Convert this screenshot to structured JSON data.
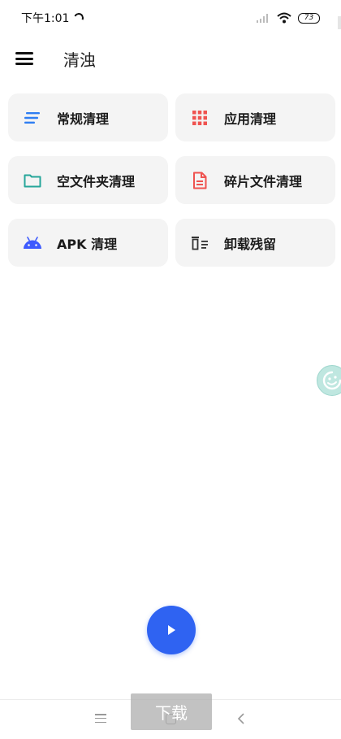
{
  "status_bar": {
    "time": "下午1:01",
    "battery": "73"
  },
  "header": {
    "title": "清浊"
  },
  "cards": [
    {
      "label": "常规清理",
      "icon": "lines-icon",
      "color": "#2f7ef2"
    },
    {
      "label": "应用清理",
      "icon": "grid-icon",
      "color": "#ef5350"
    },
    {
      "label": "空文件夹清理",
      "icon": "folder-icon",
      "color": "#26a69a"
    },
    {
      "label": "碎片文件清理",
      "icon": "document-icon",
      "color": "#ef5350"
    },
    {
      "label": "APK 清理",
      "icon": "android-icon",
      "color": "#3d5afe"
    },
    {
      "label": "卸载残留",
      "icon": "trash-list-icon",
      "color": "#333333"
    }
  ],
  "fab": {
    "icon": "play-icon",
    "color": "#2f63f2"
  },
  "overlay": {
    "download_label": "下载"
  }
}
